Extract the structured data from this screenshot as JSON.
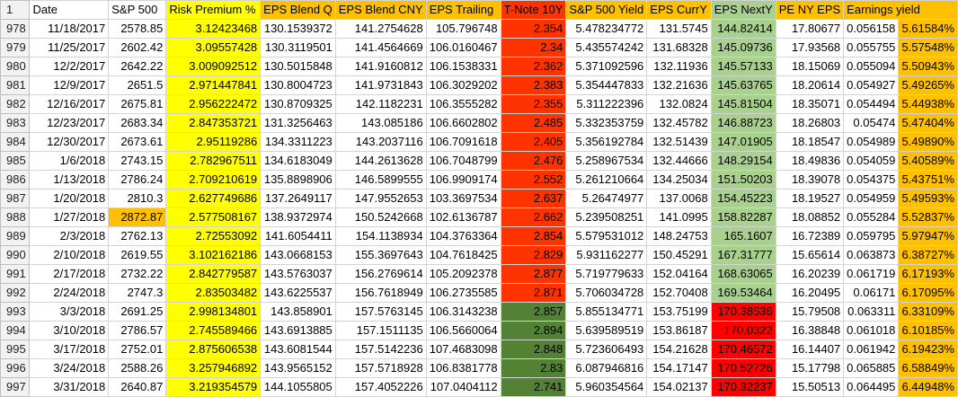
{
  "header": {
    "row_number": "1",
    "columns": [
      "Date",
      "S&P 500",
      "Risk Premium %",
      "EPS Blend Q",
      "EPS Blend CNY",
      "EPS Trailing",
      "T-Note 10Y",
      "S&P 500 Yield",
      "EPS CurrY",
      "EPS NextY",
      "PE NY EPS",
      "Earnings yield"
    ]
  },
  "colors": {
    "yellow": "#ffff00",
    "orange": "#ffc000",
    "red_orange": "#ff3300",
    "light_green": "#a9d08e",
    "red": "#ff0000",
    "dark_green": "#548235"
  },
  "rows": [
    {
      "n": "978",
      "cells": [
        "11/18/2017",
        "2578.85",
        "3.12423468",
        "130.1539372",
        "141.2754628",
        "105.796748",
        "2.354",
        "5.478234772",
        "131.5745",
        "144.82414",
        "17.80677",
        "0.056158",
        "5.61584%"
      ]
    },
    {
      "n": "979",
      "cells": [
        "11/25/2017",
        "2602.42",
        "3.09557428",
        "130.3119501",
        "141.4564669",
        "106.0160467",
        "2.34",
        "5.435574242",
        "131.68328",
        "145.09736",
        "17.93568",
        "0.055755",
        "5.57548%"
      ]
    },
    {
      "n": "980",
      "cells": [
        "12/2/2017",
        "2642.22",
        "3.009092512",
        "130.5015848",
        "141.9160812",
        "106.1538331",
        "2.362",
        "5.371092596",
        "132.11936",
        "145.57133",
        "18.15069",
        "0.055094",
        "5.50943%"
      ]
    },
    {
      "n": "981",
      "cells": [
        "12/9/2017",
        "2651.5",
        "2.971447841",
        "130.8004723",
        "141.9731843",
        "106.3029202",
        "2.383",
        "5.354447833",
        "132.21636",
        "145.63765",
        "18.20614",
        "0.054927",
        "5.49265%"
      ]
    },
    {
      "n": "982",
      "cells": [
        "12/16/2017",
        "2675.81",
        "2.956222472",
        "130.8709325",
        "142.1182231",
        "106.3555282",
        "2.355",
        "5.311222396",
        "132.0824",
        "145.81504",
        "18.35071",
        "0.054494",
        "5.44938%"
      ]
    },
    {
      "n": "983",
      "cells": [
        "12/23/2017",
        "2683.34",
        "2.847353721",
        "131.3256463",
        "143.085186",
        "106.6602802",
        "2.485",
        "5.332353759",
        "132.45782",
        "146.88723",
        "18.26803",
        "0.05474",
        "5.47404%"
      ]
    },
    {
      "n": "984",
      "cells": [
        "12/30/2017",
        "2673.61",
        "2.95119286",
        "134.3311223",
        "143.2037116",
        "106.7091618",
        "2.405",
        "5.356192784",
        "132.51439",
        "147.01905",
        "18.18547",
        "0.054989",
        "5.49890%"
      ]
    },
    {
      "n": "985",
      "cells": [
        "1/6/2018",
        "2743.15",
        "2.782967511",
        "134.6183049",
        "144.2613628",
        "106.7048799",
        "2.476",
        "5.258967534",
        "132.44666",
        "148.29154",
        "18.49836",
        "0.054059",
        "5.40589%"
      ]
    },
    {
      "n": "986",
      "cells": [
        "1/13/2018",
        "2786.24",
        "2.709210619",
        "135.8898906",
        "146.5899555",
        "106.9909174",
        "2.552",
        "5.261210664",
        "134.25034",
        "151.50203",
        "18.39078",
        "0.054375",
        "5.43751%"
      ]
    },
    {
      "n": "987",
      "cells": [
        "1/20/2018",
        "2810.3",
        "2.627749686",
        "137.2649117",
        "147.9552653",
        "103.3697534",
        "2.637",
        "5.26474977",
        "137.0068",
        "154.45223",
        "18.19527",
        "0.054959",
        "5.49593%"
      ]
    },
    {
      "n": "988",
      "cells": [
        "1/27/2018",
        "2872.87",
        "2.577508167",
        "138.9372974",
        "150.5242668",
        "102.6136787",
        "2.662",
        "5.239508251",
        "141.0995",
        "158.82287",
        "18.08852",
        "0.055284",
        "5.52837%"
      ]
    },
    {
      "n": "989",
      "cells": [
        "2/3/2018",
        "2762.13",
        "2.72553092",
        "141.6054411",
        "154.1138934",
        "104.3763364",
        "2.854",
        "5.579531012",
        "148.24753",
        "165.1607",
        "16.72389",
        "0.059795",
        "5.97947%"
      ]
    },
    {
      "n": "990",
      "cells": [
        "2/10/2018",
        "2619.55",
        "3.102162186",
        "143.0668153",
        "155.3697643",
        "104.7618425",
        "2.829",
        "5.931162277",
        "150.45291",
        "167.31777",
        "15.65614",
        "0.063873",
        "6.38727%"
      ]
    },
    {
      "n": "991",
      "cells": [
        "2/17/2018",
        "2732.22",
        "2.842779587",
        "143.5763037",
        "156.2769614",
        "105.2092378",
        "2.877",
        "5.719779633",
        "152.04164",
        "168.63065",
        "16.20239",
        "0.061719",
        "6.17193%"
      ]
    },
    {
      "n": "992",
      "cells": [
        "2/24/2018",
        "2747.3",
        "2.83503482",
        "143.6225537",
        "156.7618949",
        "106.2735585",
        "2.871",
        "5.706034728",
        "152.70408",
        "169.53464",
        "16.20495",
        "0.06171",
        "6.17095%"
      ]
    },
    {
      "n": "993",
      "cells": [
        "3/3/2018",
        "2691.25",
        "2.998134801",
        "143.858901",
        "157.5763145",
        "106.3143238",
        "2.857",
        "5.855134771",
        "153.75199",
        "170.38536",
        "15.79508",
        "0.063311",
        "6.33109%"
      ]
    },
    {
      "n": "994",
      "cells": [
        "3/10/2018",
        "2786.57",
        "2.745589466",
        "143.6913885",
        "157.1511135",
        "106.5660064",
        "2.894",
        "5.639589519",
        "153.86187",
        "170.0322",
        "16.38848",
        "0.061018",
        "6.10185%"
      ]
    },
    {
      "n": "995",
      "cells": [
        "3/17/2018",
        "2752.01",
        "2.875606538",
        "143.6081544",
        "157.5142236",
        "107.4683098",
        "2.848",
        "5.723606493",
        "154.21628",
        "170.46572",
        "16.14407",
        "0.061942",
        "6.19423%"
      ]
    },
    {
      "n": "996",
      "cells": [
        "3/24/2018",
        "2588.26",
        "3.257946892",
        "143.9565152",
        "157.5718928",
        "106.8381778",
        "2.83",
        "6.087946816",
        "154.17147",
        "170.52726",
        "15.17798",
        "0.065885",
        "6.58849%"
      ]
    },
    {
      "n": "997",
      "cells": [
        "3/31/2018",
        "2640.87",
        "3.219354579",
        "144.1055805",
        "157.4052226",
        "107.0404112",
        "2.741",
        "5.960354564",
        "154.02137",
        "170.32237",
        "15.50513",
        "0.064495",
        "6.44948%"
      ]
    }
  ]
}
